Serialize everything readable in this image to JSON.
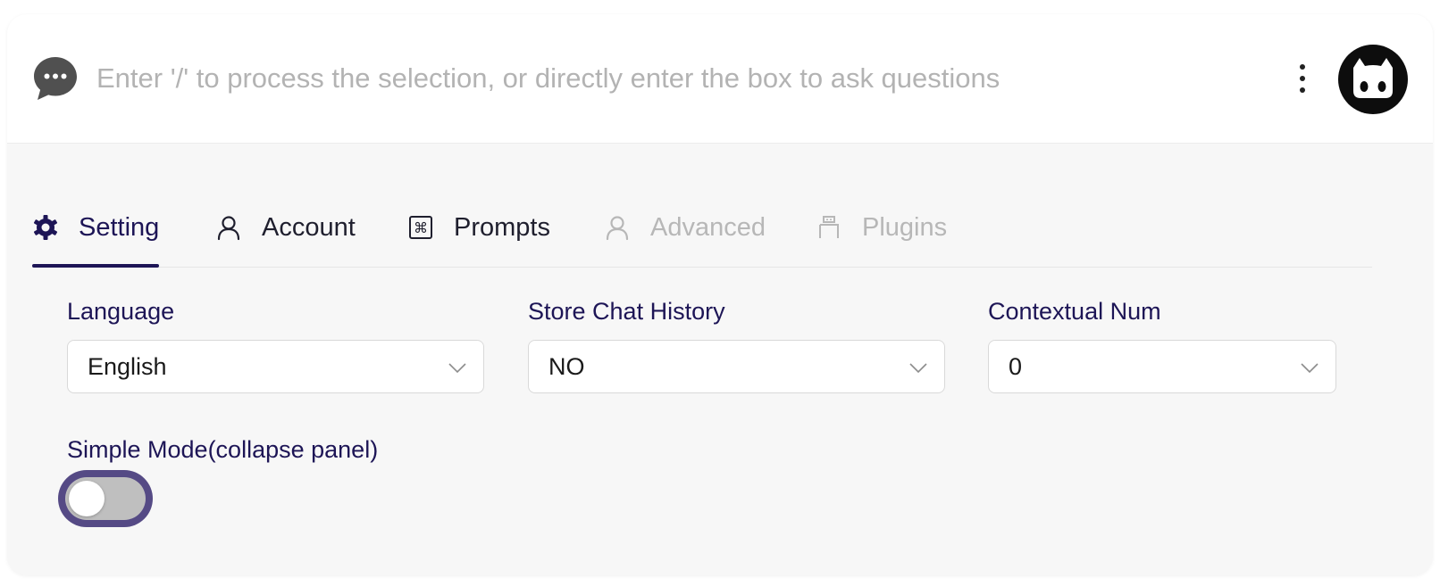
{
  "header": {
    "chat_icon": "chat-bubble-icon",
    "search_placeholder": "Enter '/' to process the selection, or directly enter the box to ask questions",
    "search_value": "",
    "more_icon": "vertical-dots-icon",
    "avatar_icon": "github-octocat-icon"
  },
  "tabs": [
    {
      "label": "Setting",
      "icon": "gear-icon",
      "state": "active"
    },
    {
      "label": "Account",
      "icon": "user-icon",
      "state": "normal"
    },
    {
      "label": "Prompts",
      "icon": "command-key-icon",
      "state": "normal"
    },
    {
      "label": "Advanced",
      "icon": "user-icon",
      "state": "disabled"
    },
    {
      "label": "Plugins",
      "icon": "plug-icon",
      "state": "disabled"
    }
  ],
  "settings": {
    "language": {
      "label": "Language",
      "value": "English"
    },
    "store_chat_history": {
      "label": "Store Chat History",
      "value": "NO"
    },
    "contextual_num": {
      "label": "Contextual Num",
      "value": "0"
    },
    "simple_mode": {
      "label": "Simple Mode(collapse panel)",
      "enabled": false
    }
  },
  "colors": {
    "accent": "#1d1556",
    "toggle_focus_ring": "#554a85",
    "toggle_off_track": "#bfbfbf",
    "disabled_text": "#b7b7b7",
    "placeholder_text": "#b3b3b3"
  }
}
